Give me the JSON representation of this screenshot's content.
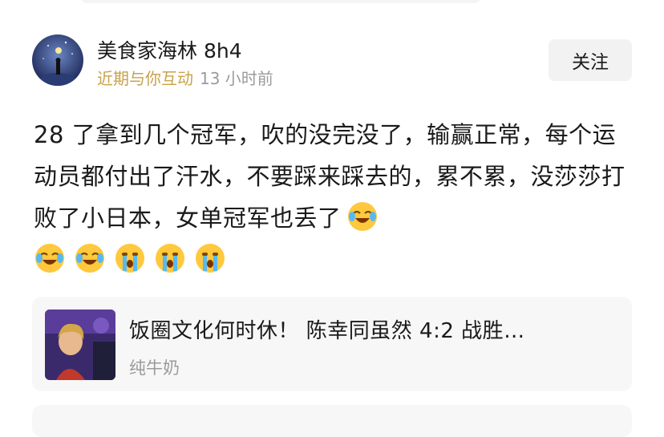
{
  "post": {
    "author": {
      "name": "美食家海林 8h4",
      "interaction_tag": "近期与你互动",
      "time_ago": "13 小时前"
    },
    "follow_label": "关注",
    "text": "28 了拿到几个冠军，吹的没完没了，输赢正常，每个运动员都付出了汗水，不要踩来踩去的，累不累，没莎莎打败了小日本，女单冠军也丢了",
    "emojis": [
      "laugh-cry",
      "laugh-cry",
      "laugh-cry",
      "crying",
      "crying",
      "crying"
    ]
  },
  "linked_card": {
    "title": "饭圈文化何时休！ 陈幸同虽然 4:2 战胜…",
    "author": "纯牛奶"
  },
  "colors": {
    "interaction_tag": "#c9a24a",
    "muted_text": "#9b9b9b",
    "card_bg": "#f7f7f7",
    "button_bg": "#f2f2f2"
  }
}
